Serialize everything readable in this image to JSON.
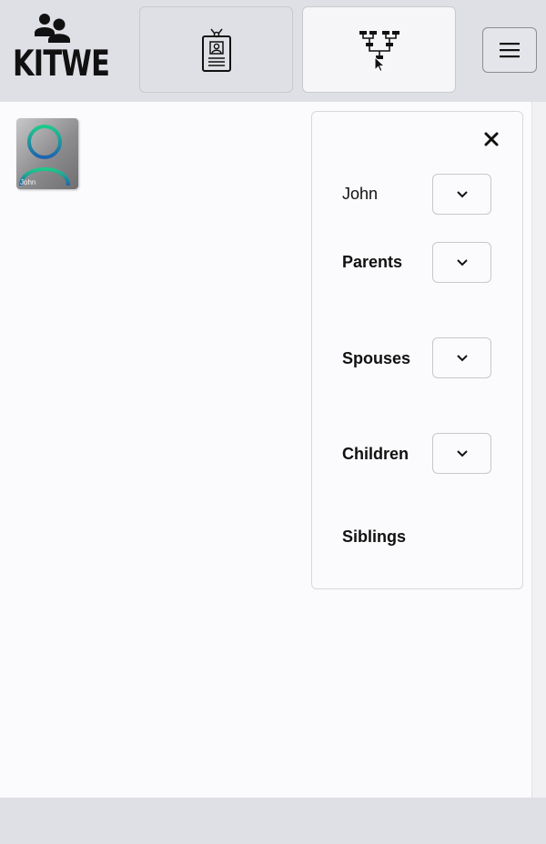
{
  "app": {
    "logo_text": "KITWE"
  },
  "header": {
    "tabs": [
      {
        "icon": "id-badge-icon",
        "active": false
      },
      {
        "icon": "family-tree-icon",
        "active": true
      }
    ],
    "menu_icon": "hamburger-menu-icon"
  },
  "canvas": {
    "persons": [
      {
        "name": "John",
        "icon": "person-avatar-icon"
      }
    ]
  },
  "panel": {
    "close_icon": "close-icon",
    "rows": [
      {
        "label": "John",
        "bold": false,
        "has_dropdown": true
      },
      {
        "label": "Parents",
        "bold": true,
        "has_dropdown": true
      },
      {
        "label": "Spouses",
        "bold": true,
        "has_dropdown": true
      },
      {
        "label": "Children",
        "bold": true,
        "has_dropdown": true
      },
      {
        "label": "Siblings",
        "bold": true,
        "has_dropdown": false
      }
    ]
  },
  "colors": {
    "header_bg": "#dfe0e5",
    "canvas_bg": "#fbfbfd",
    "avatar_accent": "#1fb58f",
    "avatar_accent_dark": "#1e6fa8"
  }
}
